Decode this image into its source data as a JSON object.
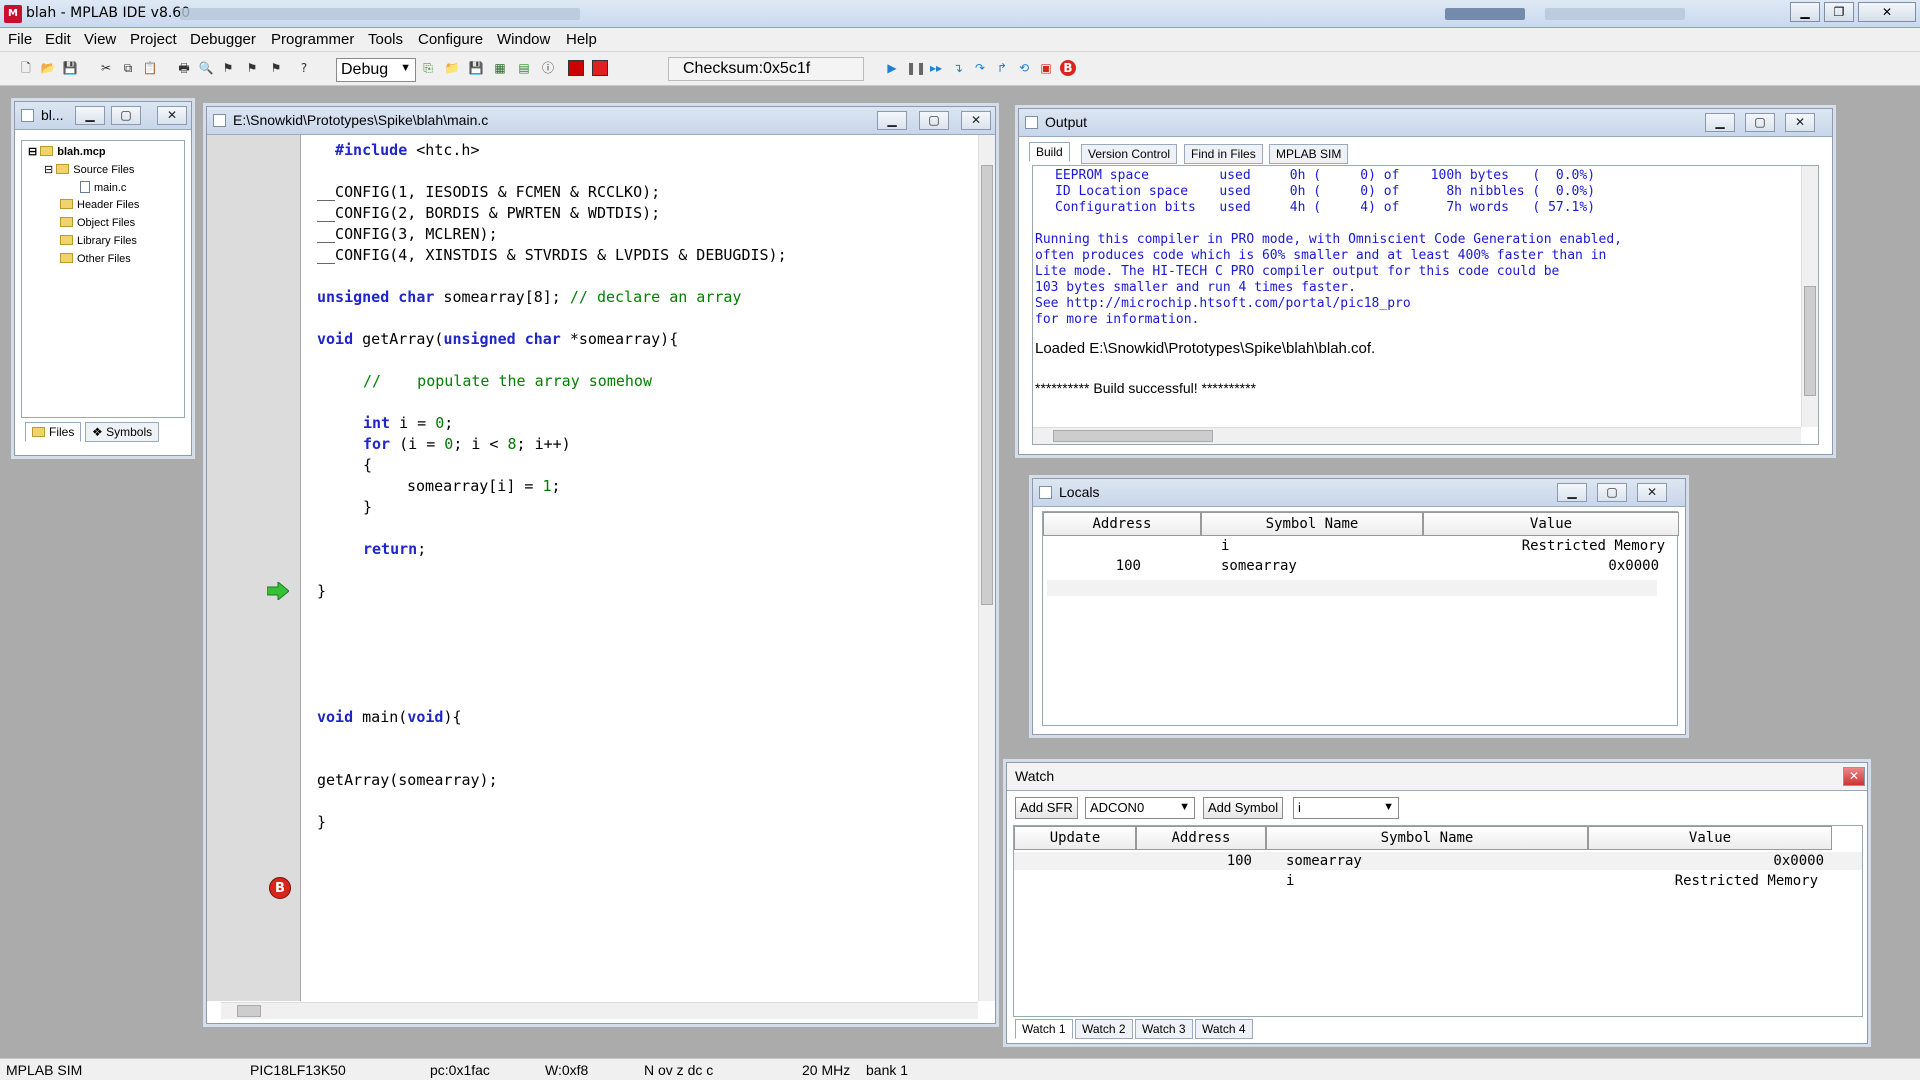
{
  "app": {
    "title": "blah - MPLAB IDE v8.60"
  },
  "menu": [
    "File",
    "Edit",
    "View",
    "Project",
    "Debugger",
    "Programmer",
    "Tools",
    "Configure",
    "Window",
    "Help"
  ],
  "toolbar": {
    "build_config": "Debug",
    "checksum": "Checksum:0x5c1f"
  },
  "project_window": {
    "title": "bl...",
    "root": "blah.mcp",
    "items": [
      "Source Files",
      "main.c",
      "Header Files",
      "Object Files",
      "Library Files",
      "Other Files"
    ],
    "tabs": [
      "Files",
      "Symbols"
    ]
  },
  "editor": {
    "path": "E:\\Snowkid\\Prototypes\\Spike\\blah\\main.c",
    "lines": {
      "l1a": "#include ",
      "l1b": "<htc.h>",
      "c1": "__CONFIG(1, IESODIS & FCMEN & RCCLKO);",
      "c2": "__CONFIG(2, BORDIS & PWRTEN & WDTDIS);",
      "c3": "__CONFIG(3, MCLREN);",
      "c4": "__CONFIG(4, XINSTDIS & STVRDIS & LVPDIS & DEBUGDIS);",
      "decl_kw": "unsigned char",
      "decl_rest": " somearray[8];",
      "decl_cm": " // declare an array",
      "fn_kw1": "void",
      "fn_name": " getArray(",
      "fn_kw2": "unsigned char",
      "fn_rest": " *somearray){",
      "cm2": "//    populate the array somehow",
      "int_kw": "int",
      "int_rest": " i = ",
      "int_num": "0",
      "int_end": ";",
      "for_kw": "for",
      "for_rest": " (i = ",
      "for_n1": "0",
      "for_mid": "; i < ",
      "for_n2": "8",
      "for_end": "; i++)",
      "ob": "{",
      "assign": "somearray[i] = ",
      "assign_num": "1",
      "assign_end": ";",
      "cb": "}",
      "ret_kw": "return",
      "ret_end": ";",
      "fend": "}",
      "main_kw1": "void",
      "main_name": " main(",
      "main_kw2": "void",
      "main_end": "){",
      "call": "getArray(somearray);",
      "mend": "}"
    }
  },
  "output": {
    "title": "Output",
    "tabs": [
      "Build",
      "Version Control",
      "Find in Files",
      "MPLAB SIM"
    ],
    "mem_rows": [
      "EEPROM space         used     0h (     0) of    100h bytes   (  0.0%)",
      "ID Location space    used     0h (     0) of      8h nibbles (  0.0%)",
      "Configuration bits   used     4h (     4) of      7h words   ( 57.1%)"
    ],
    "pro_lines": [
      "Running this compiler in PRO mode, with Omniscient Code Generation enabled,",
      "often produces code which is 60% smaller and at least 400% faster than in",
      "Lite mode. The HI-TECH C PRO compiler output for this code could be",
      "103 bytes smaller and run 4 times faster.",
      "See http://microchip.htsoft.com/portal/pic18_pro",
      "for more information."
    ],
    "loaded": "Loaded E:\\Snowkid\\Prototypes\\Spike\\blah\\blah.cof.",
    "success": "********** Build successful! **********"
  },
  "locals": {
    "title": "Locals",
    "headers": [
      "Address",
      "Symbol Name",
      "Value"
    ],
    "rows": [
      {
        "address": "",
        "symbol": "i",
        "value": "Restricted Memory"
      },
      {
        "address": "100",
        "symbol": "somearray",
        "value": "0x0000"
      }
    ]
  },
  "watch": {
    "title": "Watch",
    "add_sfr": "Add SFR",
    "sfr_value": "ADCON0",
    "add_symbol": "Add Symbol",
    "symbol_value": "i",
    "headers": [
      "Update",
      "Address",
      "Symbol Name",
      "Value"
    ],
    "rows": [
      {
        "update": "",
        "address": "100",
        "symbol": "somearray",
        "value": "0x0000"
      },
      {
        "update": "",
        "address": "",
        "symbol": "i",
        "value": "Restricted Memory"
      }
    ],
    "tabs": [
      "Watch 1",
      "Watch 2",
      "Watch 3",
      "Watch 4"
    ]
  },
  "status": {
    "debugger": "MPLAB SIM",
    "device": "PIC18LF13K50",
    "pc": "pc:0x1fac",
    "w": "W:0xf8",
    "flags": "N ov z dc c",
    "freq": "20 MHz",
    "bank": "bank 1"
  },
  "colors": {
    "keyword": "#1f25c8",
    "comment": "#008000",
    "breakpoint": "#d9261c",
    "pc_arrow": "#36c236",
    "compiler_note": "#1a1ad2"
  }
}
